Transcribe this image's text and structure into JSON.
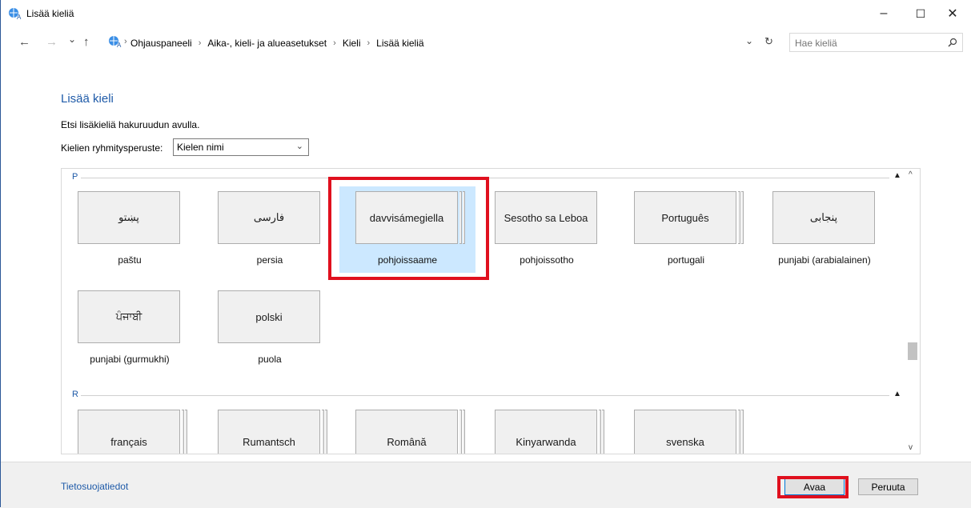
{
  "window": {
    "title": "Lisää kieliä",
    "minimize": "–",
    "maximize": "☐",
    "close": "✕"
  },
  "nav": {
    "back": "←",
    "forward": "→",
    "recent": "⌄",
    "up": "↑",
    "breadcrumbs": [
      "Ohjauspaneeli",
      "Aika-, kieli- ja alueasetukset",
      "Kieli",
      "Lisää kieliä"
    ],
    "separator": "›",
    "dropdown": "⌄",
    "refresh": "↻",
    "search_placeholder": "Hae kieliä"
  },
  "main": {
    "heading": "Lisää kieli",
    "description": "Etsi lisäkieliä hakuruudun avulla.",
    "group_label": "Kielien ryhmitysperuste:",
    "group_value": "Kielen nimi"
  },
  "sections": [
    {
      "letter": "P",
      "tiles": [
        {
          "native": "پښتو",
          "caption": "paštu",
          "selected": false,
          "stacked": false
        },
        {
          "native": "فارسی",
          "caption": "persia",
          "selected": false,
          "stacked": false
        },
        {
          "native": "davvisámegiella",
          "caption": "pohjoissaame",
          "selected": true,
          "stacked": true
        },
        {
          "native": "Sesotho sa Leboa",
          "caption": "pohjoissotho",
          "selected": false,
          "stacked": false
        },
        {
          "native": "Português",
          "caption": "portugali",
          "selected": false,
          "stacked": true
        },
        {
          "native": "پنجابی",
          "caption": "punjabi (arabialainen)",
          "selected": false,
          "stacked": false
        },
        {
          "native": "ਪੰਜਾਬੀ",
          "caption": "punjabi (gurmukhi)",
          "selected": false,
          "stacked": false
        },
        {
          "native": "polski",
          "caption": "puola",
          "selected": false,
          "stacked": false
        }
      ]
    },
    {
      "letter": "R",
      "tiles": [
        {
          "native": "français",
          "caption": "",
          "selected": false,
          "stacked": true
        },
        {
          "native": "Rumantsch",
          "caption": "",
          "selected": false,
          "stacked": true
        },
        {
          "native": "Română",
          "caption": "",
          "selected": false,
          "stacked": true
        },
        {
          "native": "Kinyarwanda",
          "caption": "",
          "selected": false,
          "stacked": true
        },
        {
          "native": "svenska",
          "caption": "",
          "selected": false,
          "stacked": true
        }
      ]
    }
  ],
  "footer": {
    "privacy_link": "Tietosuojatiedot",
    "open_button": "Avaa",
    "cancel_button": "Peruuta"
  },
  "colors": {
    "accent": "#1e5aa8",
    "highlight": "#e0101e",
    "selection": "#cce8ff"
  }
}
